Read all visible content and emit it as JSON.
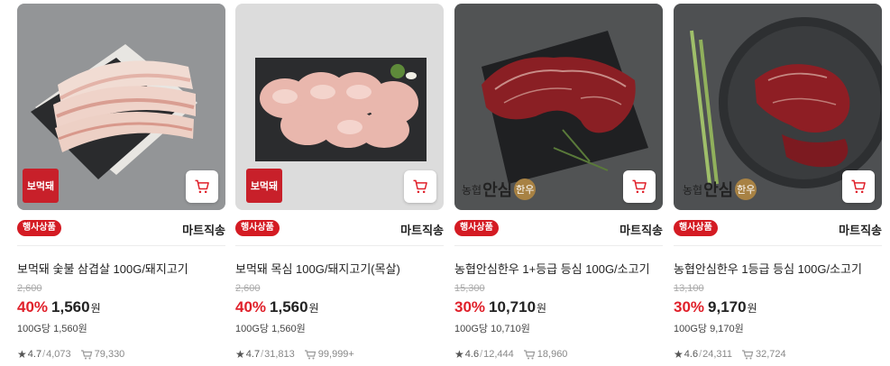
{
  "products": [
    {
      "badge": "행사상품",
      "delivery": "마트직송",
      "title": "보먹돼 숯불 삼겹살 100G/돼지고기",
      "original_price": "2,600",
      "discount": "40%",
      "price": "1,560",
      "currency": "원",
      "unit_price": "100G당 1,560원",
      "rating": "4.7",
      "reviews": "4,073",
      "views": "79,330",
      "logo": "보먹돼"
    },
    {
      "badge": "행사상품",
      "delivery": "마트직송",
      "title": "보먹돼 목심 100G/돼지고기(목살)",
      "original_price": "2,600",
      "discount": "40%",
      "price": "1,560",
      "currency": "원",
      "unit_price": "100G당 1,560원",
      "rating": "4.7",
      "reviews": "31,813",
      "views": "99,999+",
      "logo": "보먹돼"
    },
    {
      "badge": "행사상품",
      "delivery": "마트직송",
      "title": "농협안심한우 1+등급 등심 100G/소고기",
      "original_price": "15,300",
      "discount": "30%",
      "price": "10,710",
      "currency": "원",
      "unit_price": "100G당 10,710원",
      "rating": "4.6",
      "reviews": "12,444",
      "views": "18,960",
      "logo_prefix": "농협",
      "logo_main": "안심",
      "logo_suffix": "한우"
    },
    {
      "badge": "행사상품",
      "delivery": "마트직송",
      "title": "농협안심한우 1등급 등심 100G/소고기",
      "original_price": "13,100",
      "discount": "30%",
      "price": "9,170",
      "currency": "원",
      "unit_price": "100G당 9,170원",
      "rating": "4.6",
      "reviews": "24,311",
      "views": "32,724",
      "logo_prefix": "농협",
      "logo_main": "안심",
      "logo_suffix": "한우"
    }
  ],
  "colors": {
    "badge": "#d41b23",
    "discount": "#e0202a",
    "cart": "#e0202a"
  },
  "icons": {
    "cart": "cart-icon",
    "star": "star-icon",
    "views": "view-count-icon"
  }
}
